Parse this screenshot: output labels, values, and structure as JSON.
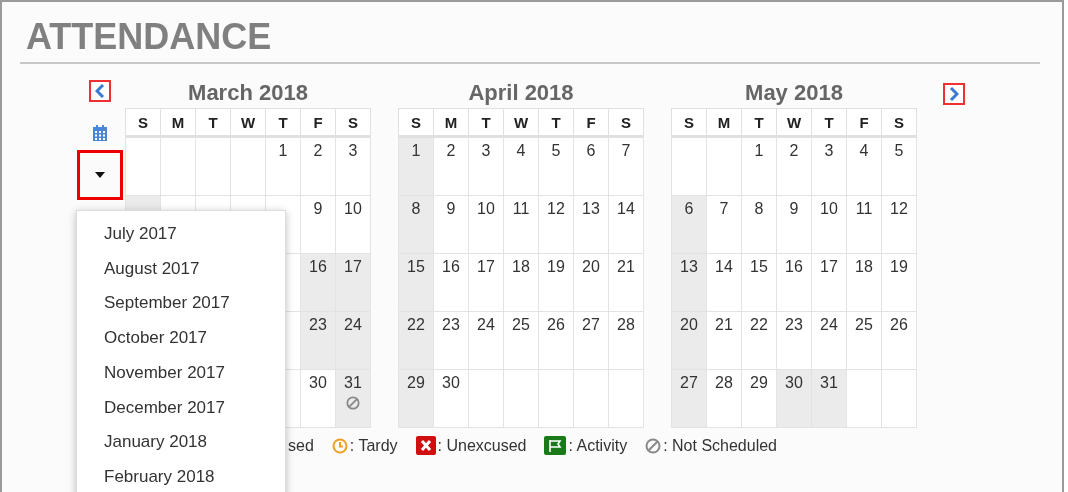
{
  "title": "ATTENDANCE",
  "months": [
    {
      "title": "March 2018",
      "weekdays": [
        "S",
        "M",
        "T",
        "W",
        "T",
        "F",
        "S"
      ],
      "weeks": [
        [
          {
            "shaded": false
          },
          {
            "shaded": false
          },
          {
            "shaded": false
          },
          {
            "shaded": false
          },
          {
            "day": "1",
            "shaded": false
          },
          {
            "day": "2",
            "shaded": false
          },
          {
            "day": "3",
            "shaded": false
          }
        ],
        [
          {
            "shaded": true
          },
          {
            "shaded": false
          },
          {
            "shaded": false
          },
          {
            "shaded": false
          },
          {
            "shaded": false
          },
          {
            "day": "9",
            "shaded": false
          },
          {
            "day": "10",
            "shaded": false
          }
        ],
        [
          {
            "shaded": false
          },
          {
            "day": "16",
            "shaded": true
          },
          {
            "day": "17",
            "shaded": true
          }
        ],
        [
          {
            "shaded": false
          },
          {
            "day": "23",
            "shaded": true
          },
          {
            "day": "24",
            "shaded": true
          }
        ],
        [
          {
            "shaded": false
          },
          {
            "day": "30",
            "shaded": false
          },
          {
            "day": "31",
            "shaded": true,
            "kind": "not_scheduled"
          }
        ]
      ]
    },
    {
      "title": "April 2018",
      "weekdays": [
        "S",
        "M",
        "T",
        "W",
        "T",
        "F",
        "S"
      ],
      "weeks": [
        [
          {
            "day": "1",
            "shaded": true
          },
          {
            "day": "2",
            "shaded": false
          },
          {
            "day": "3",
            "shaded": false
          },
          {
            "day": "4",
            "shaded": false
          },
          {
            "day": "5",
            "shaded": false
          },
          {
            "day": "6",
            "shaded": false
          },
          {
            "day": "7",
            "shaded": false
          }
        ],
        [
          {
            "day": "8",
            "shaded": true
          },
          {
            "day": "9",
            "shaded": false
          },
          {
            "day": "10",
            "shaded": false
          },
          {
            "day": "11",
            "shaded": false
          },
          {
            "day": "12",
            "shaded": false
          },
          {
            "day": "13",
            "shaded": false
          },
          {
            "day": "14",
            "shaded": false
          }
        ],
        [
          {
            "day": "15",
            "shaded": true
          },
          {
            "day": "16",
            "shaded": false
          },
          {
            "day": "17",
            "shaded": false
          },
          {
            "day": "18",
            "shaded": false
          },
          {
            "day": "19",
            "shaded": false
          },
          {
            "day": "20",
            "shaded": false
          },
          {
            "day": "21",
            "shaded": false
          }
        ],
        [
          {
            "day": "22",
            "shaded": true
          },
          {
            "day": "23",
            "shaded": false
          },
          {
            "day": "24",
            "shaded": false
          },
          {
            "day": "25",
            "shaded": false
          },
          {
            "day": "26",
            "shaded": false
          },
          {
            "day": "27",
            "shaded": false
          },
          {
            "day": "28",
            "shaded": false
          }
        ],
        [
          {
            "day": "29",
            "shaded": true
          },
          {
            "day": "30",
            "shaded": false
          },
          {
            "shaded": false
          },
          {
            "shaded": false
          },
          {
            "shaded": false
          },
          {
            "shaded": false
          },
          {
            "shaded": false
          }
        ]
      ]
    },
    {
      "title": "May 2018",
      "weekdays": [
        "S",
        "M",
        "T",
        "W",
        "T",
        "F",
        "S"
      ],
      "weeks": [
        [
          {
            "shaded": false
          },
          {
            "shaded": false
          },
          {
            "day": "1",
            "shaded": false
          },
          {
            "day": "2",
            "shaded": false
          },
          {
            "day": "3",
            "shaded": false
          },
          {
            "day": "4",
            "shaded": false
          },
          {
            "day": "5",
            "shaded": false
          }
        ],
        [
          {
            "day": "6",
            "shaded": true
          },
          {
            "day": "7",
            "shaded": false
          },
          {
            "day": "8",
            "shaded": false
          },
          {
            "day": "9",
            "shaded": false
          },
          {
            "day": "10",
            "shaded": false
          },
          {
            "day": "11",
            "shaded": false
          },
          {
            "day": "12",
            "shaded": false
          }
        ],
        [
          {
            "day": "13",
            "shaded": true
          },
          {
            "day": "14",
            "shaded": false
          },
          {
            "day": "15",
            "shaded": false
          },
          {
            "day": "16",
            "shaded": false
          },
          {
            "day": "17",
            "shaded": false
          },
          {
            "day": "18",
            "shaded": false
          },
          {
            "day": "19",
            "shaded": false
          }
        ],
        [
          {
            "day": "20",
            "shaded": true
          },
          {
            "day": "21",
            "shaded": false
          },
          {
            "day": "22",
            "shaded": false
          },
          {
            "day": "23",
            "shaded": false
          },
          {
            "day": "24",
            "shaded": false
          },
          {
            "day": "25",
            "shaded": false
          },
          {
            "day": "26",
            "shaded": false
          }
        ],
        [
          {
            "day": "27",
            "shaded": true
          },
          {
            "day": "28",
            "shaded": false
          },
          {
            "day": "29",
            "shaded": false
          },
          {
            "day": "30",
            "shaded": true
          },
          {
            "day": "31",
            "shaded": true
          },
          {
            "shaded": false
          },
          {
            "shaded": false
          }
        ]
      ]
    }
  ],
  "legend": [
    {
      "label": "sed"
    },
    {
      "kind": "tardy",
      "label": ": Tardy"
    },
    {
      "kind": "unexcused",
      "label": ": Unexcused"
    },
    {
      "kind": "activity",
      "label": ": Activity"
    },
    {
      "kind": "not_scheduled",
      "label": ": Not Scheduled"
    }
  ],
  "month_menu": {
    "expanded": true,
    "items": [
      "July 2017",
      "August 2017",
      "September 2017",
      "October 2017",
      "November 2017",
      "December 2017",
      "January 2018",
      "February 2018"
    ]
  }
}
